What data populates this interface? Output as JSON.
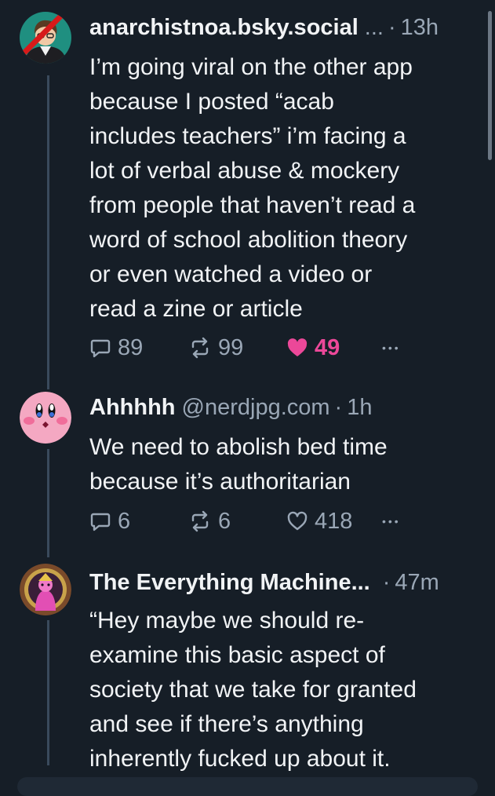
{
  "posts": [
    {
      "name": "anarchistnoa.bsky.social",
      "handle": "",
      "ellipsis": "...",
      "dot": "·",
      "time": "13h",
      "text_lines": [
        "I’m going viral on the other app",
        "because I posted “acab",
        "includes teachers” i’m facing a",
        "lot of verbal abuse & mockery",
        "from people that haven’t read a",
        "word of school abolition theory",
        "or even watched a video or",
        "read a zine or article"
      ],
      "replies": "89",
      "reposts": "99",
      "likes": "49",
      "liked": true,
      "more": "•••"
    },
    {
      "name": "Ahhhhh",
      "handle": "@nerdjpg.com",
      "ellipsis": "",
      "dot": "·",
      "time": "1h",
      "text_lines": [
        "We need to abolish bed time",
        "because it’s authoritarian"
      ],
      "replies": "6",
      "reposts": "6",
      "likes": "418",
      "liked": false,
      "more": "•••"
    },
    {
      "name": "The Everything Machine...",
      "handle": "",
      "ellipsis": "",
      "dot": "·",
      "time": "47m",
      "text_lines": [
        "“Hey maybe we should re-",
        "examine this basic aspect of",
        "society that we take for granted",
        "and see if there’s anything",
        "inherently fucked up about it."
      ]
    }
  ],
  "colors": {
    "background": "#161e27",
    "muted": "#9aa7b6",
    "like": "#ec4899",
    "thread_line": "#3a4a5c"
  }
}
